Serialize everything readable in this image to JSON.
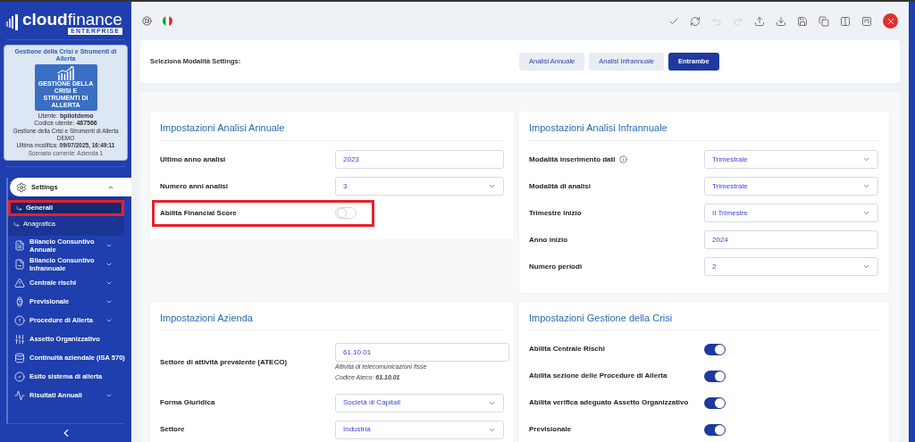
{
  "sidebar": {
    "logo": {
      "bold": "cloud",
      "light": "finance",
      "badge": "ENTERPRISE"
    },
    "info_card": {
      "title": "Gestione della Crisi e Strumenti di Allerta",
      "app_caption": "GESTIONE DELLA CRISI E STRUMENTI DI ALLERTA",
      "user_label": "Utente:",
      "user": "bpilotdemo",
      "code_label": "Codice utente:",
      "code": "487566",
      "product": "Gestione della Crisi e Strumenti di Allerta DEMO",
      "modified_label": "Ultima modifica:",
      "modified": "09/07/2025, 16:49:11",
      "scenario": "Scenario corrente: Azienda 1"
    },
    "items": [
      {
        "label": "Settings",
        "kind": "gear",
        "expanded": true,
        "children": [
          {
            "label": "Generali",
            "selected": true,
            "highlighted": true
          },
          {
            "label": "Anagrafica",
            "selected": false,
            "highlighted": false
          }
        ]
      },
      {
        "label": "Bilancio Consuntivo Annuale",
        "kind": "document",
        "expanded": false
      },
      {
        "label": "Bilancio Consuntivo Infrannuale",
        "kind": "document-minus",
        "expanded": false
      },
      {
        "label": "Centrale rischi",
        "kind": "warning",
        "expanded": false
      },
      {
        "label": "Previsionale",
        "kind": "watch",
        "expanded": false
      },
      {
        "label": "Procedure di Allerta",
        "kind": "alert",
        "expanded": false
      },
      {
        "label": "Assetto Organizzativo",
        "kind": "sliders"
      },
      {
        "label": "Continuità aziendale (ISA 570)",
        "kind": "database"
      },
      {
        "label": "Esito sistema di allerta",
        "kind": "check-circle"
      },
      {
        "label": "Risultati Annuali",
        "kind": "pulse",
        "expanded": false
      }
    ]
  },
  "toolbar": {
    "left": [
      {
        "kind": "lifebuoy"
      },
      {
        "kind": "flag"
      }
    ],
    "right": [
      {
        "kind": "check",
        "disabled": false
      },
      {
        "kind": "refresh",
        "disabled": false
      },
      {
        "kind": "undo",
        "disabled": true
      },
      {
        "kind": "redo",
        "disabled": true
      },
      {
        "kind": "upload",
        "disabled": false
      },
      {
        "kind": "download",
        "disabled": false
      },
      {
        "kind": "save",
        "disabled": false
      },
      {
        "kind": "copy",
        "disabled": false
      },
      {
        "kind": "columns",
        "disabled": false
      },
      {
        "kind": "board",
        "disabled": false
      },
      {
        "kind": "close",
        "disabled": false
      }
    ]
  },
  "mode_selector": {
    "label": "Seleziona Modalità Settings:",
    "options": [
      {
        "label": "Analisi Annuale",
        "selected": false
      },
      {
        "label": "Analisi Infrannuale",
        "selected": false
      },
      {
        "label": "Entrambe",
        "selected": true
      }
    ]
  },
  "panels": [
    {
      "title": "Impostazioni Analisi Annuale",
      "rows": [
        {
          "label": "Ultimo anno analisi",
          "kind": "input",
          "value": "2023"
        },
        {
          "label": "Numero anni analisi",
          "kind": "select",
          "value": "3"
        },
        {
          "label": "Abilita Financial Score",
          "kind": "toggle",
          "on": false,
          "highlighted": true
        }
      ]
    },
    {
      "title": "Impostazioni Analisi Infrannuale",
      "rows": [
        {
          "label": "Modalità inserimento dati",
          "kind": "select",
          "value": "Trimestrale",
          "info": true
        },
        {
          "label": "Modalità di analisi",
          "kind": "select",
          "value": "Trimestrale"
        },
        {
          "label": "Trimestre inizio",
          "kind": "select",
          "value": "II Trimestre"
        },
        {
          "label": "Anno inizio",
          "kind": "input",
          "value": "2024"
        },
        {
          "label": "Numero periodi",
          "kind": "select",
          "value": "2"
        }
      ]
    },
    {
      "title": "Impostazioni Azienda",
      "rows": [
        {
          "label": "Settore di attività prevalente (ATECO)",
          "kind": "ateco",
          "value": "61.10.01",
          "notes": [
            "Attività di telecomunicazioni fisse",
            "Codice Ateco: **61.10.01**"
          ]
        },
        {
          "label": "Forma Giuridica",
          "kind": "select",
          "value": "Società di Capitali"
        },
        {
          "label": "Settore",
          "kind": "select",
          "value": "Industria"
        }
      ]
    },
    {
      "title": "Impostazioni Gestione della Crisi",
      "rows": [
        {
          "label": "Abilita Centrale Rischi",
          "kind": "toggle",
          "on": true
        },
        {
          "label": "Abilita sezione delle Procedure di Allerta",
          "kind": "toggle",
          "on": true
        },
        {
          "label": "Abilita verifica adeguato Assetto Organizzativo",
          "kind": "toggle",
          "on": true
        },
        {
          "label": "Previsionale",
          "kind": "toggle",
          "on": true
        }
      ]
    }
  ]
}
